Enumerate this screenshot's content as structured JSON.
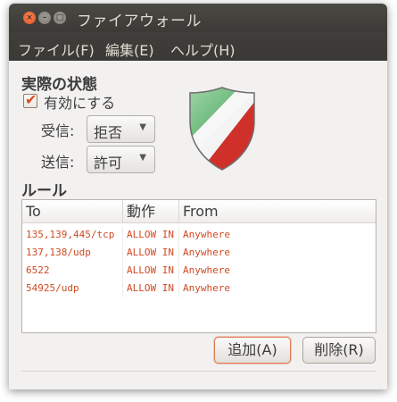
{
  "window": {
    "title": "ファイアウォール",
    "buttons": {
      "close": "×",
      "min": "–",
      "max": "□"
    }
  },
  "menu": {
    "items": [
      {
        "label": "ファイル(F)"
      },
      {
        "label": "編集(E)"
      },
      {
        "label": "ヘルプ(H)"
      }
    ]
  },
  "status": {
    "heading": "実際の状態",
    "enable_label": "有効にする",
    "enabled": true,
    "incoming_label": "受信:",
    "incoming_value": "拒否",
    "outgoing_label": "送信:",
    "outgoing_value": "許可"
  },
  "rules": {
    "heading": "ルール",
    "columns": [
      "To",
      "動作",
      "From"
    ],
    "rows": [
      {
        "to": "135,139,445/tcp",
        "action": "ALLOW IN",
        "from": "Anywhere"
      },
      {
        "to": "137,138/udp",
        "action": "ALLOW IN",
        "from": "Anywhere"
      },
      {
        "to": "6522",
        "action": "ALLOW IN",
        "from": "Anywhere"
      },
      {
        "to": "54925/udp",
        "action": "ALLOW IN",
        "from": "Anywhere"
      }
    ]
  },
  "buttons": {
    "add": "追加(A)",
    "delete": "削除(R)"
  },
  "icons": {
    "shield": "gufw-shield-icon",
    "check": "check-icon",
    "dropdown": "chevron-down-icon"
  },
  "colors": {
    "accent": "#dd4814",
    "rule_text": "#cf4a22",
    "titlebar": "#3c3b37"
  }
}
